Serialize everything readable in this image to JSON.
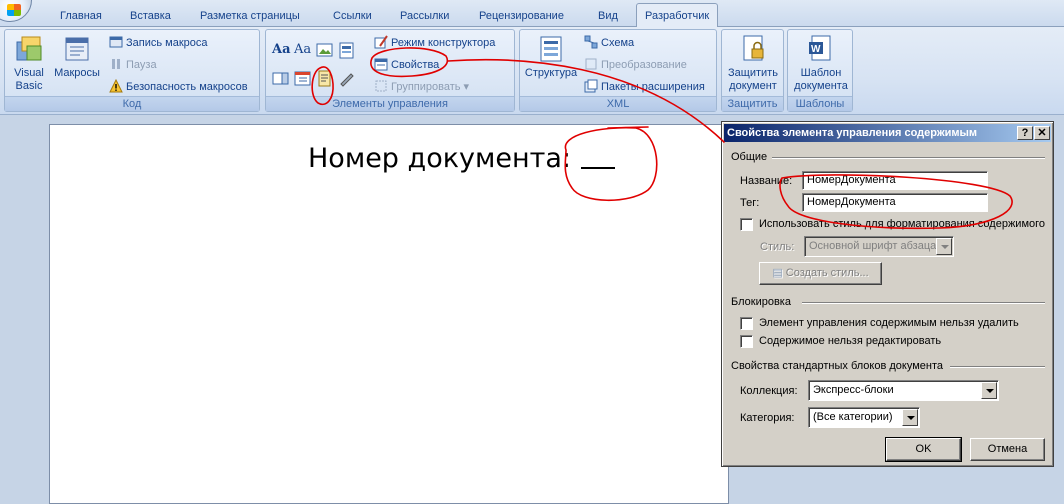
{
  "tabs": [
    {
      "label": "Главная",
      "active": false
    },
    {
      "label": "Вставка",
      "active": false
    },
    {
      "label": "Разметка страницы",
      "active": false
    },
    {
      "label": "Ссылки",
      "active": false
    },
    {
      "label": "Рассылки",
      "active": false
    },
    {
      "label": "Рецензирование",
      "active": false
    },
    {
      "label": "Вид",
      "active": false
    },
    {
      "label": "Разработчик",
      "active": true
    }
  ],
  "ribbon": {
    "code": {
      "label": "Код",
      "visual_basic": "Visual\nBasic",
      "macros": "Макросы",
      "record_macro": "Запись макроса",
      "pause": "Пауза",
      "macro_security": "Безопасность макросов"
    },
    "controls": {
      "label": "Элементы управления",
      "design_mode": "Режим конструктора",
      "properties": "Свойства",
      "group": "Группировать"
    },
    "xml": {
      "label": "XML",
      "structure": "Структура",
      "schema": "Схема",
      "transform": "Преобразование",
      "expansion_packs": "Пакеты расширения"
    },
    "protect": {
      "label": "Защитить",
      "protect_document": "Защитить\nдокумент"
    },
    "templates": {
      "label": "Шаблоны",
      "document_template": "Шаблон\nдокумента"
    }
  },
  "document": {
    "text": "Номер документа:"
  },
  "dialog": {
    "title": "Свойства элемента управления содержимым",
    "help_btn": "?",
    "close_btn": "✕",
    "general": {
      "title": "Общие",
      "name_label": "Название:",
      "name_value": "НомерДокумента",
      "tag_label": "Тег:",
      "tag_value": "НомерДокумента",
      "use_style_label": "Использовать стиль для форматирования содержимого",
      "style_label": "Стиль:",
      "style_value": "Основной шрифт абзаца",
      "new_style_btn": "Создать стиль..."
    },
    "locking": {
      "title": "Блокировка",
      "cannot_delete": "Элемент управления содержимым нельзя удалить",
      "cannot_edit": "Содержимое нельзя редактировать"
    },
    "building_blocks": {
      "title": "Свойства стандартных блоков документа",
      "gallery_label": "Коллекция:",
      "gallery_value": "Экспресс-блоки",
      "category_label": "Категория:",
      "category_value": "(Все категории)"
    },
    "ok_btn": "OK",
    "cancel_btn": "Отмена"
  },
  "colors": {
    "annotation": "#e00000",
    "title_bar_start": "#0a246a",
    "title_bar_end": "#a6caf0",
    "dialog_face": "#d4d0c8"
  }
}
